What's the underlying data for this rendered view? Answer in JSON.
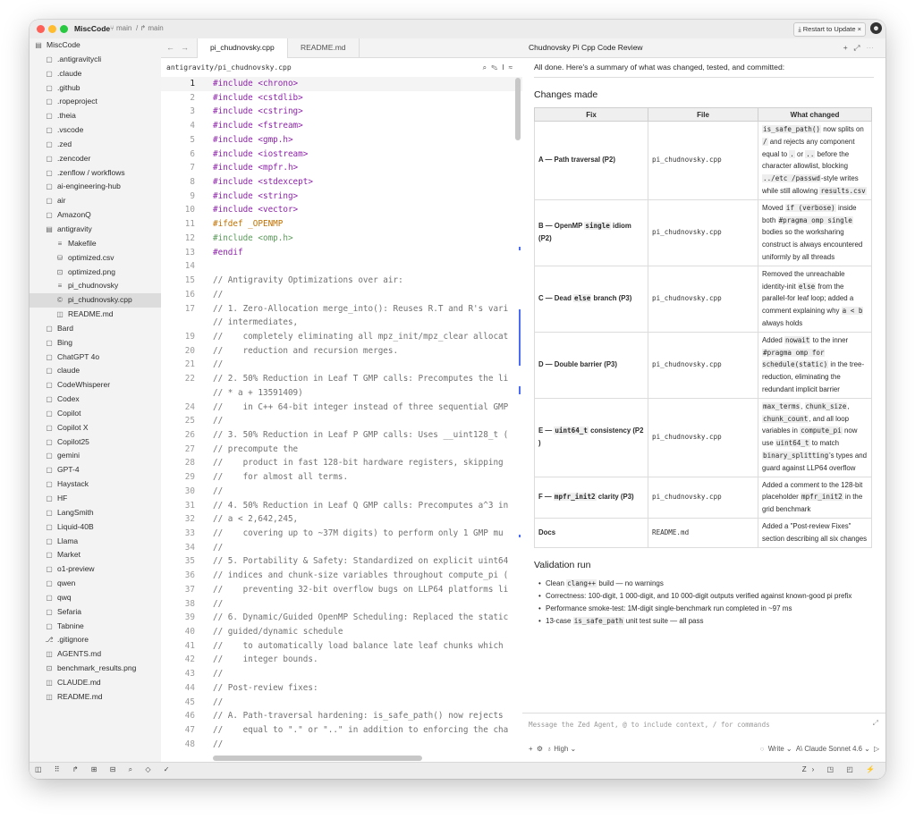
{
  "titlebar": {
    "project": "MiscCode",
    "branch1": "⑂ main",
    "branch2": "/ ↱ main",
    "restart": "⤓ Restart to Update",
    "close": "×"
  },
  "sidebar": {
    "root": "MiscCode",
    "items": [
      {
        "icon": "▢",
        "label": ".antigravitycli",
        "indent": 1
      },
      {
        "icon": "▢",
        "label": ".claude",
        "indent": 1
      },
      {
        "icon": "▢",
        "label": ".github",
        "indent": 1
      },
      {
        "icon": "▢",
        "label": ".ropeproject",
        "indent": 1
      },
      {
        "icon": "▢",
        "label": ".theia",
        "indent": 1
      },
      {
        "icon": "▢",
        "label": ".vscode",
        "indent": 1
      },
      {
        "icon": "▢",
        "label": ".zed",
        "indent": 1
      },
      {
        "icon": "▢",
        "label": ".zencoder",
        "indent": 1
      },
      {
        "icon": "▢",
        "label": ".zenflow / workflows",
        "indent": 1
      },
      {
        "icon": "▢",
        "label": "ai-engineering-hub",
        "indent": 1
      },
      {
        "icon": "▢",
        "label": "air",
        "indent": 1
      },
      {
        "icon": "▢",
        "label": "AmazonQ",
        "indent": 1
      },
      {
        "icon": "▤",
        "label": "antigravity",
        "indent": 1
      },
      {
        "icon": "≡",
        "label": "Makefile",
        "indent": 2
      },
      {
        "icon": "⛁",
        "label": "optimized.csv",
        "indent": 2
      },
      {
        "icon": "⊡",
        "label": "optimized.png",
        "indent": 2
      },
      {
        "icon": "≡",
        "label": "pi_chudnovsky",
        "indent": 2
      },
      {
        "icon": "©",
        "label": "pi_chudnovsky.cpp",
        "indent": 2,
        "selected": true
      },
      {
        "icon": "◫",
        "label": "README.md",
        "indent": 2
      },
      {
        "icon": "▢",
        "label": "Bard",
        "indent": 1
      },
      {
        "icon": "▢",
        "label": "Bing",
        "indent": 1
      },
      {
        "icon": "▢",
        "label": "ChatGPT 4o",
        "indent": 1
      },
      {
        "icon": "▢",
        "label": "claude",
        "indent": 1
      },
      {
        "icon": "▢",
        "label": "CodeWhisperer",
        "indent": 1
      },
      {
        "icon": "▢",
        "label": "Codex",
        "indent": 1
      },
      {
        "icon": "▢",
        "label": "Copilot",
        "indent": 1
      },
      {
        "icon": "▢",
        "label": "Copilot X",
        "indent": 1
      },
      {
        "icon": "▢",
        "label": "Copilot25",
        "indent": 1
      },
      {
        "icon": "▢",
        "label": "gemini",
        "indent": 1
      },
      {
        "icon": "▢",
        "label": "GPT-4",
        "indent": 1
      },
      {
        "icon": "▢",
        "label": "Haystack",
        "indent": 1
      },
      {
        "icon": "▢",
        "label": "HF",
        "indent": 1
      },
      {
        "icon": "▢",
        "label": "LangSmith",
        "indent": 1
      },
      {
        "icon": "▢",
        "label": "Liquid-40B",
        "indent": 1
      },
      {
        "icon": "▢",
        "label": "Llama",
        "indent": 1
      },
      {
        "icon": "▢",
        "label": "Market",
        "indent": 1
      },
      {
        "icon": "▢",
        "label": "o1-preview",
        "indent": 1
      },
      {
        "icon": "▢",
        "label": "qwen",
        "indent": 1
      },
      {
        "icon": "▢",
        "label": "qwq",
        "indent": 1
      },
      {
        "icon": "▢",
        "label": "Sefaria",
        "indent": 1
      },
      {
        "icon": "▢",
        "label": "Tabnine",
        "indent": 1
      },
      {
        "icon": "⎇",
        "label": ".gitignore",
        "indent": 1
      },
      {
        "icon": "◫",
        "label": "AGENTS.md",
        "indent": 1
      },
      {
        "icon": "⊡",
        "label": "benchmark_results.png",
        "indent": 1
      },
      {
        "icon": "◫",
        "label": "CLAUDE.md",
        "indent": 1
      },
      {
        "icon": "◫",
        "label": "README.md",
        "indent": 1
      }
    ]
  },
  "editor": {
    "tabs": [
      "pi_chudnovsky.cpp",
      "README.md"
    ],
    "path": "antigravity/pi_chudnovsky.cpp",
    "lines": [
      {
        "n": "1",
        "t": "#include <chrono>",
        "c": "kw"
      },
      {
        "n": "2",
        "t": "#include <cstdlib>",
        "c": "kw"
      },
      {
        "n": "3",
        "t": "#include <cstring>",
        "c": "kw"
      },
      {
        "n": "4",
        "t": "#include <fstream>",
        "c": "kw"
      },
      {
        "n": "5",
        "t": "#include <gmp.h>",
        "c": "kw"
      },
      {
        "n": "6",
        "t": "#include <iostream>",
        "c": "kw"
      },
      {
        "n": "7",
        "t": "#include <mpfr.h>",
        "c": "kw"
      },
      {
        "n": "8",
        "t": "#include <stdexcept>",
        "c": "kw"
      },
      {
        "n": "9",
        "t": "#include <string>",
        "c": "kw"
      },
      {
        "n": "10",
        "t": "#include <vector>",
        "c": "kw"
      },
      {
        "n": "11",
        "t": "#ifdef _OPENMP",
        "c": "pp"
      },
      {
        "n": "12",
        "t": "#include <omp.h>",
        "c": "dim"
      },
      {
        "n": "13",
        "t": "#endif",
        "c": "kw"
      },
      {
        "n": "14",
        "t": "",
        "c": "cm"
      },
      {
        "n": "15",
        "t": "// Antigravity Optimizations over air:",
        "c": "cm"
      },
      {
        "n": "16",
        "t": "//",
        "c": "cm"
      },
      {
        "n": "17",
        "t": "// 1. Zero-Allocation merge_into(): Reuses R.T and R's vari",
        "c": "cm"
      },
      {
        "n": "",
        "t": "// intermediates,",
        "c": "cm"
      },
      {
        "n": "19",
        "t": "//    completely eliminating all mpz_init/mpz_clear allocat",
        "c": "cm"
      },
      {
        "n": "20",
        "t": "//    reduction and recursion merges.",
        "c": "cm"
      },
      {
        "n": "21",
        "t": "//",
        "c": "cm"
      },
      {
        "n": "22",
        "t": "// 2. 50% Reduction in Leaf T GMP calls: Precomputes the li",
        "c": "cm"
      },
      {
        "n": "",
        "t": "// * a + 13591409)",
        "c": "cm"
      },
      {
        "n": "24",
        "t": "//    in C++ 64-bit integer instead of three sequential GMP",
        "c": "cm"
      },
      {
        "n": "25",
        "t": "//",
        "c": "cm"
      },
      {
        "n": "26",
        "t": "// 3. 50% Reduction in Leaf P GMP calls: Uses __uint128_t (",
        "c": "cm"
      },
      {
        "n": "27",
        "t": "// precompute the",
        "c": "cm"
      },
      {
        "n": "28",
        "t": "//    product in fast 128-bit hardware registers, skipping ",
        "c": "cm"
      },
      {
        "n": "29",
        "t": "//    for almost all terms.",
        "c": "cm"
      },
      {
        "n": "30",
        "t": "//",
        "c": "cm"
      },
      {
        "n": "31",
        "t": "// 4. 50% Reduction in Leaf Q GMP calls: Precomputes a^3 in",
        "c": "cm"
      },
      {
        "n": "32",
        "t": "// a < 2,642,245,",
        "c": "cm"
      },
      {
        "n": "33",
        "t": "//    covering up to ~37M digits) to perform only 1 GMP mu",
        "c": "cm"
      },
      {
        "n": "34",
        "t": "//",
        "c": "cm"
      },
      {
        "n": "35",
        "t": "// 5. Portability & Safety: Standardized on explicit uint64",
        "c": "cm"
      },
      {
        "n": "36",
        "t": "// indices and chunk-size variables throughout compute_pi (",
        "c": "cm"
      },
      {
        "n": "37",
        "t": "//    preventing 32-bit overflow bugs on LLP64 platforms li",
        "c": "cm"
      },
      {
        "n": "38",
        "t": "//",
        "c": "cm"
      },
      {
        "n": "39",
        "t": "// 6. Dynamic/Guided OpenMP Scheduling: Replaced the static",
        "c": "cm"
      },
      {
        "n": "40",
        "t": "// guided/dynamic schedule",
        "c": "cm"
      },
      {
        "n": "41",
        "t": "//    to automatically load balance late leaf chunks which ",
        "c": "cm"
      },
      {
        "n": "42",
        "t": "//    integer bounds.",
        "c": "cm"
      },
      {
        "n": "43",
        "t": "//",
        "c": "cm"
      },
      {
        "n": "44",
        "t": "// Post-review fixes:",
        "c": "cm"
      },
      {
        "n": "45",
        "t": "//",
        "c": "cm"
      },
      {
        "n": "46",
        "t": "// A. Path-traversal hardening: is_safe_path() now rejects ",
        "c": "cm"
      },
      {
        "n": "47",
        "t": "//    equal to \".\" or \"..\" in addition to enforcing the cha",
        "c": "cm"
      },
      {
        "n": "48",
        "t": "//",
        "c": "cm"
      }
    ]
  },
  "agent": {
    "title": "Chudnovsky Pi Cpp Code Review",
    "summary": "All done. Here's a summary of what was changed, tested, and committed:",
    "changes_heading": "Changes made",
    "table_headers": [
      "Fix",
      "File",
      "What changed"
    ],
    "rows": [
      {
        "fix": "A — Path traversal (P2)",
        "file": "pi_chudnovsky.cpp",
        "what": "<code>is_safe_path()</code> now splits on <code>/</code> and rejects any component equal to <code>.</code> or <code>..</code> before the character allowlist, blocking <code>../etc /passwd</code>-style writes while still allowing <code>results.csv</code>"
      },
      {
        "fix": "B — OpenMP <code>single</code> idiom (P2)",
        "file": "pi_chudnovsky.cpp",
        "what": "Moved <code>if (verbose)</code> inside both <code>#pragma omp single</code> bodies so the worksharing construct is always encountered uniformly by all threads"
      },
      {
        "fix": "C — Dead <code>else</code> branch (P3)",
        "file": "pi_chudnovsky.cpp",
        "what": "Removed the unreachable identity-init <code>else</code> from the parallel-for leaf loop; added a comment explaining why <code>a &lt; b</code> always holds"
      },
      {
        "fix": "D — Double barrier (P3)",
        "file": "pi_chudnovsky.cpp",
        "what": "Added <code>nowait</code> to the inner <code>#pragma omp for schedule(static)</code> in the tree-reduction, eliminating the redundant implicit barrier"
      },
      {
        "fix": "E — <code>uint64_t</code> consistency (P2 )",
        "file": "pi_chudnovsky.cpp",
        "what": "<code>max_terms</code>, <code>chunk_size</code>, <code>chunk_count</code>, and all loop variables in <code>compute_pi</code> now use <code>uint64_t</code> to match <code>binary_splitting</code>'s types and guard against LLP64 overflow"
      },
      {
        "fix": "F — <code>mpfr_init2</code> clarity (P3)",
        "file": "pi_chudnovsky.cpp",
        "what": "Added a comment to the 128-bit placeholder <code>mpfr_init2</code> in the grid benchmark"
      },
      {
        "fix": "Docs",
        "file": "README.md",
        "what": "Added a \"Post-review Fixes\" section describing all six changes"
      }
    ],
    "validation_heading": "Validation run",
    "validation": [
      "Clean <code>clang++</code> build — no warnings",
      "Correctness: 100-digit, 1 000-digit, and 10 000-digit outputs verified against known-good pi prefix",
      "Performance smoke-test: 1M-digit single-benchmark run completed in ~97 ms",
      "13-case <code>is_safe_path</code> unit test suite — all pass"
    ],
    "input_placeholder": "Message the Zed Agent, @ to include context, / for commands",
    "effort": "High ⌄",
    "mode": "Write ⌄",
    "model": "Claude Sonnet 4.6 ⌄"
  },
  "statusbar": {
    "left": "◫ ⠿ ↱ ⊞ ⊟ ⌕ ◇ ✓",
    "right": "Z› ◳ ◰ ⚡"
  }
}
